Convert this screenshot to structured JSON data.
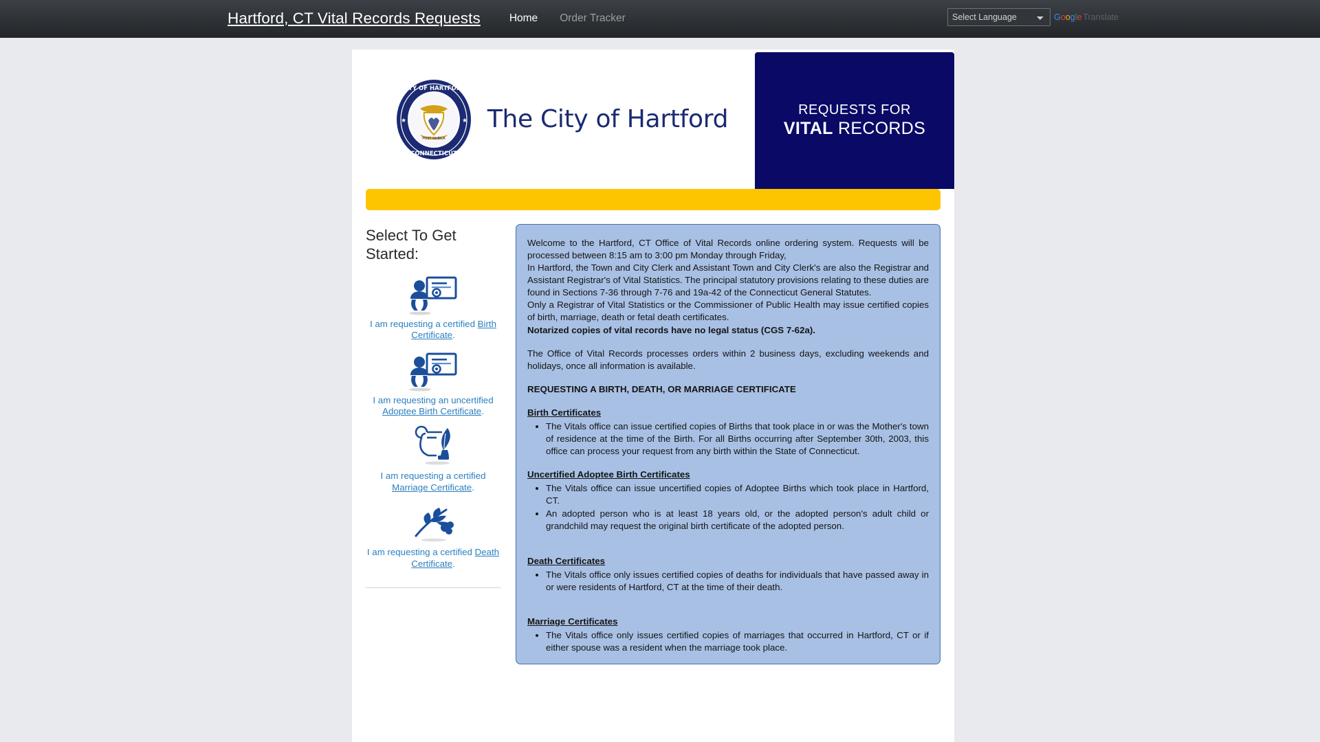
{
  "navbar": {
    "brand": "Hartford, CT Vital Records Requests",
    "links": [
      {
        "label": "Home",
        "active": true
      },
      {
        "label": "Order Tracker",
        "active": false
      }
    ],
    "language": {
      "selected": "Select Language",
      "options": [
        "Select Language"
      ],
      "attribution": "Translate",
      "google_letters": [
        "G",
        "o",
        "o",
        "g",
        "l",
        "e"
      ]
    }
  },
  "banner": {
    "seal_alt": "City of Hartford Connecticut Seal",
    "seal_text_top": "CITY OF HARTFORD",
    "seal_text_bottom": "CONNECTICUT",
    "seal_motto": "POST NUBILA PHOEBUS",
    "city_title": "The City of Hartford",
    "requests_line1": "REQUESTS FOR",
    "requests_line2_bold": "VITAL",
    "requests_line2_rest": " RECORDS",
    "colors": {
      "navy": "#0a0a66",
      "gold": "#fdc500",
      "title_blue": "#1b2a72"
    }
  },
  "sidebar": {
    "title": "Select To Get Started:",
    "options": [
      {
        "icon": "baby-certificate-icon",
        "prefix": "I am requesting a certified ",
        "link": "Birth Certificate",
        "suffix": "."
      },
      {
        "icon": "baby-certificate-icon",
        "prefix": "I am requesting an uncertified ",
        "link": "Adoptee Birth Certificate",
        "suffix": "."
      },
      {
        "icon": "quill-ink-icon",
        "prefix": "I am requesting a certified ",
        "link": "Marriage Certificate",
        "suffix": "."
      },
      {
        "icon": "olive-branch-icon",
        "prefix": "I am requesting a certified ",
        "link": "Death Certificate",
        "suffix": "."
      }
    ]
  },
  "content": {
    "intro1": "Welcome to the Hartford, CT Office of Vital Records online ordering system. Requests will be processed between 8:15 am to 3:00 pm Monday through Friday,",
    "intro2": "In Hartford, the Town and City Clerk and Assistant Town and City Clerk's are also the Registrar and Assistant Registrar's of Vital Statistics.  The principal statutory provisions relating to these duties are found in Sections 7-36 through 7-76 and 19a-42 of the Connecticut General Statutes.",
    "intro3": "Only a Registrar of Vital Statistics or the Commissioner of Public Health may issue certified copies of birth, marriage, death or fetal death certificates.",
    "notarized_notice": "Notarized copies of vital records have no legal status (CGS 7-62a).",
    "processing": "The Office of Vital Records processes orders within 2 business days, excluding weekends and holidays, once all information is available.",
    "section_heading": "REQUESTING A BIRTH, DEATH, OR MARRIAGE CERTIFICATE",
    "sections": [
      {
        "heading": "Birth Certificates ",
        "bullets": [
          "The Vitals office can issue certified copies of Births that took place in or was the Mother's town of residence at the time of the Birth.  For all Births occurring after September 30th, 2003, this office can process your request from any birth within the State of Connecticut."
        ]
      },
      {
        "heading": " Uncertified Adoptee Birth Certificates ",
        "bullets": [
          "The Vitals office can issue uncertified copies of Adoptee Births which took place in Hartford, CT.",
          "An adopted person who is at least 18 years old, or the adopted person's adult child or grandchild may request the original birth certificate of the adopted person."
        ]
      },
      {
        "heading": "Death Certificates ",
        "bullets": [
          "The Vitals office only issues certified copies of deaths for individuals that have passed away in or were residents of Hartford, CT at the time of their death."
        ]
      },
      {
        "heading": "Marriage Certificates ",
        "bullets": [
          "The Vitals office only issues certified copies of marriages that occurred in Hartford, CT or if either spouse was a resident when the marriage took place."
        ]
      }
    ]
  }
}
